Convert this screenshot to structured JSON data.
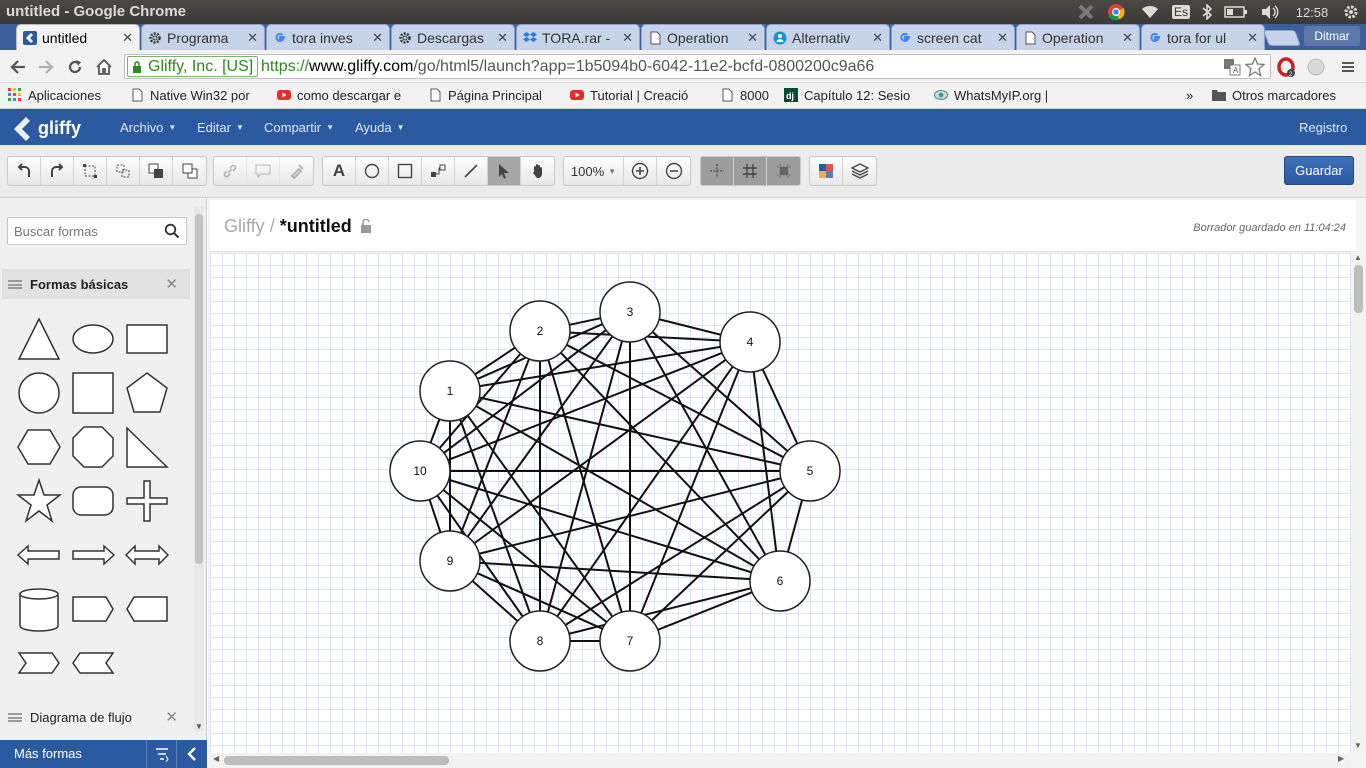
{
  "window": {
    "title": "untitled - Google Chrome"
  },
  "system_tray": {
    "keyboard": "Es",
    "clock": "12:58"
  },
  "tabs": [
    {
      "label": "untitled",
      "icon": "gliffy-icon",
      "active": true
    },
    {
      "label": "Programa",
      "icon": "gear-icon"
    },
    {
      "label": "tora inves",
      "icon": "google-icon"
    },
    {
      "label": "Descargas",
      "icon": "gear-icon"
    },
    {
      "label": "TORA.rar -",
      "icon": "dropbox-icon"
    },
    {
      "label": "Operation",
      "icon": "page-icon"
    },
    {
      "label": "Alternativ",
      "icon": "person-icon"
    },
    {
      "label": "screen cat",
      "icon": "google-icon"
    },
    {
      "label": "Operation",
      "icon": "page-icon"
    },
    {
      "label": "tora for ul",
      "icon": "google-icon"
    }
  ],
  "user": {
    "name": "Ditmar"
  },
  "address_bar": {
    "ev_label": "Gliffy, Inc. [US]",
    "scheme": "https://",
    "host": "www.gliffy.com",
    "path": "/go/html5/launch?app=1b5094b0-6042-11e2-bcfd-0800200c9a66"
  },
  "bookmarks": [
    {
      "label": "Aplicaciones",
      "icon": "apps-grid-icon"
    },
    {
      "label": "Native Win32 por",
      "icon": "page-icon"
    },
    {
      "label": "como descargar e",
      "icon": "youtube-icon"
    },
    {
      "label": "Página Principal",
      "icon": "page-icon"
    },
    {
      "label": "Tutorial | Creació",
      "icon": "youtube-icon"
    },
    {
      "label": "8000",
      "icon": "page-icon"
    },
    {
      "label": "Capítulo 12: Sesio",
      "icon": "dj-icon"
    },
    {
      "label": "WhatsMyIP.org |",
      "icon": "whatsmyip-icon"
    }
  ],
  "bookmarks_overflow": "»",
  "other_bookmarks": "Otros marcadores",
  "app": {
    "logo": "gliffy",
    "menus": [
      "Archivo",
      "Editar",
      "Compartir",
      "Ayuda"
    ],
    "register": "Registro"
  },
  "toolbar": {
    "zoom": "100%",
    "save_label": "Guardar",
    "text_tool": "A"
  },
  "sidebar": {
    "search_placeholder": "Buscar formas",
    "panel_basic": "Formas básicas",
    "panel_flow": "Diagrama de flujo",
    "more_shapes": "Más formas"
  },
  "document": {
    "breadcrumb_root": "Gliffy",
    "breadcrumb_sep": "/",
    "title": "*untitled",
    "draft_saved": "Borrador guardado en 11:04:24"
  },
  "diagram": {
    "node_labels": [
      "1",
      "2",
      "3",
      "4",
      "5",
      "6",
      "7",
      "8",
      "9",
      "10"
    ],
    "edges": "complete"
  },
  "colors": {
    "brand_blue": "#2c5aa0",
    "tab_strip": "#3d5f9e",
    "grid_line": "#dde3ef"
  }
}
